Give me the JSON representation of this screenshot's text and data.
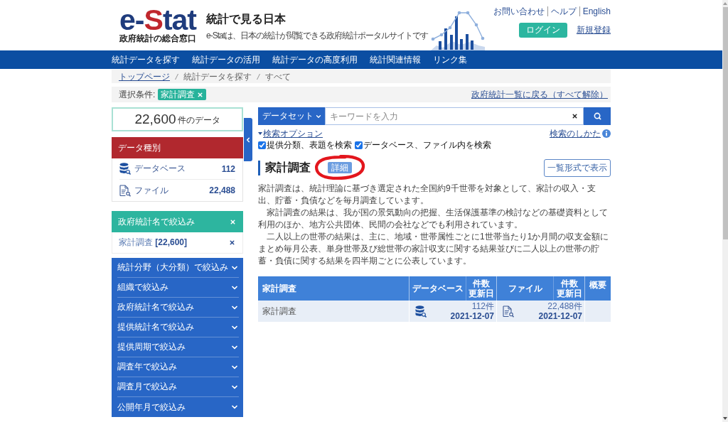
{
  "header": {
    "logo": {
      "segments": [
        {
          "text": "e-",
          "color": "#1f3c7d"
        },
        {
          "text": "S",
          "color": "#c0272d"
        },
        {
          "text": "tat",
          "color": "#1f3c7d"
        }
      ]
    },
    "logo_subtitle": "政府統計の総合窓口",
    "title": "統計で見る日本",
    "tagline": "e-Statは、日本の統計が閲覧できる政府統計ポータルサイトです",
    "utility_links": [
      "お問い合わせ",
      "ヘルプ",
      "English"
    ],
    "login_button": "ログイン",
    "register_link": "新規登録"
  },
  "nav": [
    "統計データを探す",
    "統計データの活用",
    "統計データの高度利用",
    "統計関連情報",
    "リンク集"
  ],
  "breadcrumb": [
    {
      "label": "トップページ",
      "link": true
    },
    {
      "label": "統計データを探す",
      "link": false
    },
    {
      "label": "すべて",
      "link": false
    }
  ],
  "selection": {
    "label": "選択条件:",
    "tags": [
      "家計調査"
    ],
    "reset_link": "政府統計一覧に戻る（すべて解除）"
  },
  "sidebar": {
    "count": {
      "value": "22,600",
      "unit": "件のデータ"
    },
    "data_types": {
      "title": "データ種別",
      "items": [
        {
          "kind": "database",
          "label": "データベース",
          "count": "112"
        },
        {
          "kind": "file",
          "label": "ファイル",
          "count": "22,488"
        }
      ]
    },
    "active_filter": {
      "title": "政府統計名で絞込み",
      "values": [
        "家計調査 **[22,600]**"
      ]
    },
    "filters": [
      {
        "label": "統計分野（大分類）で絞込み",
        "expanded": false
      },
      {
        "label": "組織で絞込み",
        "expanded": false
      },
      {
        "label": "政府統計名で絞込み",
        "expanded": false
      },
      {
        "label": "提供統計名で絞込み",
        "expanded": false
      },
      {
        "label": "提供周期で絞込み",
        "expanded": false
      },
      {
        "label": "調査年で絞込み",
        "expanded": false
      },
      {
        "label": "調査月で絞込み",
        "expanded": false
      },
      {
        "label": "公開年月で絞込み",
        "expanded": false
      }
    ]
  },
  "search": {
    "scope": "データセット",
    "placeholder": "キーワードを入力",
    "options_link": "検索オプション",
    "help_link": "検索のしかた",
    "options": [
      {
        "label": "提供分類、表題を検索",
        "checked": true
      },
      {
        "label": "データベース、ファイル内を検索",
        "checked": true
      }
    ]
  },
  "statistic": {
    "title": "家計調査",
    "detail_button": {
      "label": "詳細",
      "circled": true
    },
    "list_view_button": "一覧形式で表示",
    "paragraphs": [
      "家計調査は、統計理論に基づき選定された全国約9千世帯を対象として、家計の収入・支出、貯蓄・負債などを毎月調査しています。",
      "家計調査の結果は、我が国の景気動向の把握、生活保護基準の検討などの基礎資料として利用のほか、地方公共団体、民間の会社などでも利用されています。",
      "二人以上の世帯の結果は、主に、地域・世帯属性ごとに1世帯当たり1か月間の収支金額にまとめ毎月公表、単身世帯及び総世帯の家計収支に関する結果並びに二人以上の世帯の貯蓄・負債に関する結果を四半期ごとに公表しています。"
    ]
  },
  "table": {
    "columns": [
      {
        "kind": "single",
        "label": "家計調査"
      },
      {
        "kind": "single",
        "label": "データベース"
      },
      {
        "kind": "stacked",
        "lines": [
          "件数",
          "更新日"
        ]
      },
      {
        "kind": "single",
        "label": "ファイル"
      },
      {
        "kind": "stacked",
        "lines": [
          "件数",
          "更新日"
        ]
      },
      {
        "kind": "single",
        "label": "概要"
      }
    ],
    "rows": [
      {
        "name": "家計調査",
        "database": {
          "count": "112",
          "unit": "件",
          "updated": "2021-12-07"
        },
        "file": {
          "count": "22,488",
          "unit": "件",
          "updated": "2021-12-07"
        }
      }
    ]
  }
}
